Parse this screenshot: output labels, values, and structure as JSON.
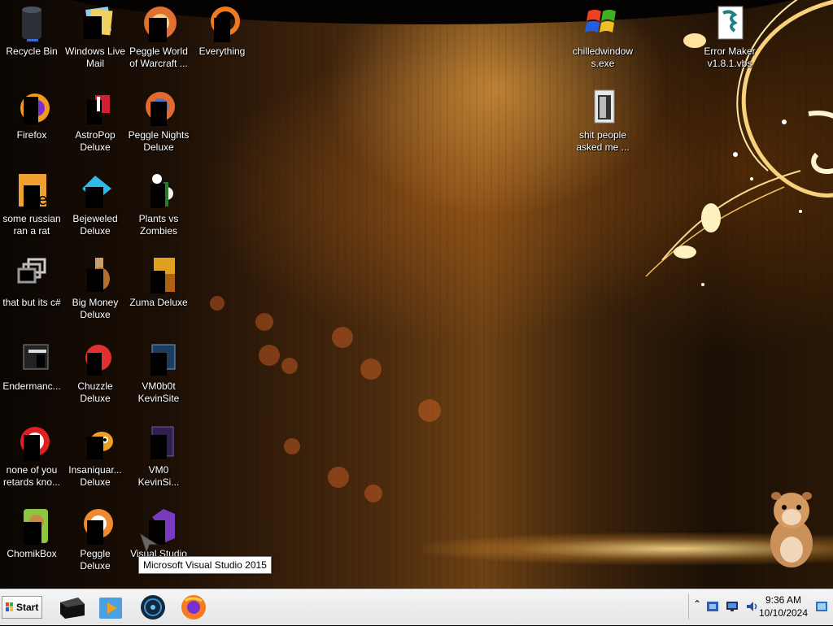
{
  "desktop": {
    "icons": [
      {
        "label": "Recycle Bin",
        "icon": "recycle-bin-icon"
      },
      {
        "label": "Windows Live Mail",
        "icon": "windows-live-mail-icon"
      },
      {
        "label": "Peggle World of Warcraft ...",
        "icon": "peggle-wow-icon"
      },
      {
        "label": "Everything",
        "icon": "everything-search-icon"
      },
      {
        "label": "Firefox",
        "icon": "firefox-icon"
      },
      {
        "label": "AstroPop Deluxe",
        "icon": "astropop-icon"
      },
      {
        "label": "Peggle Nights Deluxe",
        "icon": "peggle-nights-icon"
      },
      {
        "label": "some russian ran a rat",
        "icon": "folder-icon"
      },
      {
        "label": "Bejeweled Deluxe",
        "icon": "bejeweled-icon"
      },
      {
        "label": "Plants vs Zombies",
        "icon": "plants-vs-zombies-icon"
      },
      {
        "label": "that but its c#",
        "icon": "shortcut-icon"
      },
      {
        "label": "Big Money Deluxe",
        "icon": "big-money-icon"
      },
      {
        "label": "Zuma Deluxe",
        "icon": "zuma-icon"
      },
      {
        "label": "Endermanc...",
        "icon": "terminal-icon"
      },
      {
        "label": "Chuzzle Deluxe",
        "icon": "chuzzle-icon"
      },
      {
        "label": "VM0b0t KevinSite",
        "icon": "vm-icon"
      },
      {
        "label": "none of you retards kno...",
        "icon": "app-icon"
      },
      {
        "label": "Insaniquar... Deluxe",
        "icon": "insaniquarium-icon"
      },
      {
        "label": "VM0 KevinSi...",
        "icon": "vm-file-icon"
      },
      {
        "label": "ChomikBox",
        "icon": "chomikbox-icon"
      },
      {
        "label": "Peggle Deluxe",
        "icon": "peggle-icon"
      },
      {
        "label": "Visual Studio",
        "icon": "visual-studio-icon"
      },
      {
        "label": "chilledwindows.exe",
        "icon": "windows-xp-flag-icon"
      },
      {
        "label": "Error Maker v1.8.1.vbs",
        "icon": "script-file-icon"
      },
      {
        "label": "shit people asked me ...",
        "icon": "folder-icon"
      }
    ],
    "tooltip": "Microsoft Visual Studio 2015"
  },
  "taskbar": {
    "start_label": "Start",
    "pinned": [
      {
        "name": "explorer-app-icon"
      },
      {
        "name": "media-player-icon"
      },
      {
        "name": "globe-app-icon"
      },
      {
        "name": "firefox-icon"
      }
    ],
    "tray": {
      "time": "9:36 AM",
      "date": "10/10/2024"
    }
  },
  "colors": {
    "taskbar_bg": "#eeeeee",
    "label_text": "#ffffff",
    "accent_orange": "#f0a030"
  }
}
